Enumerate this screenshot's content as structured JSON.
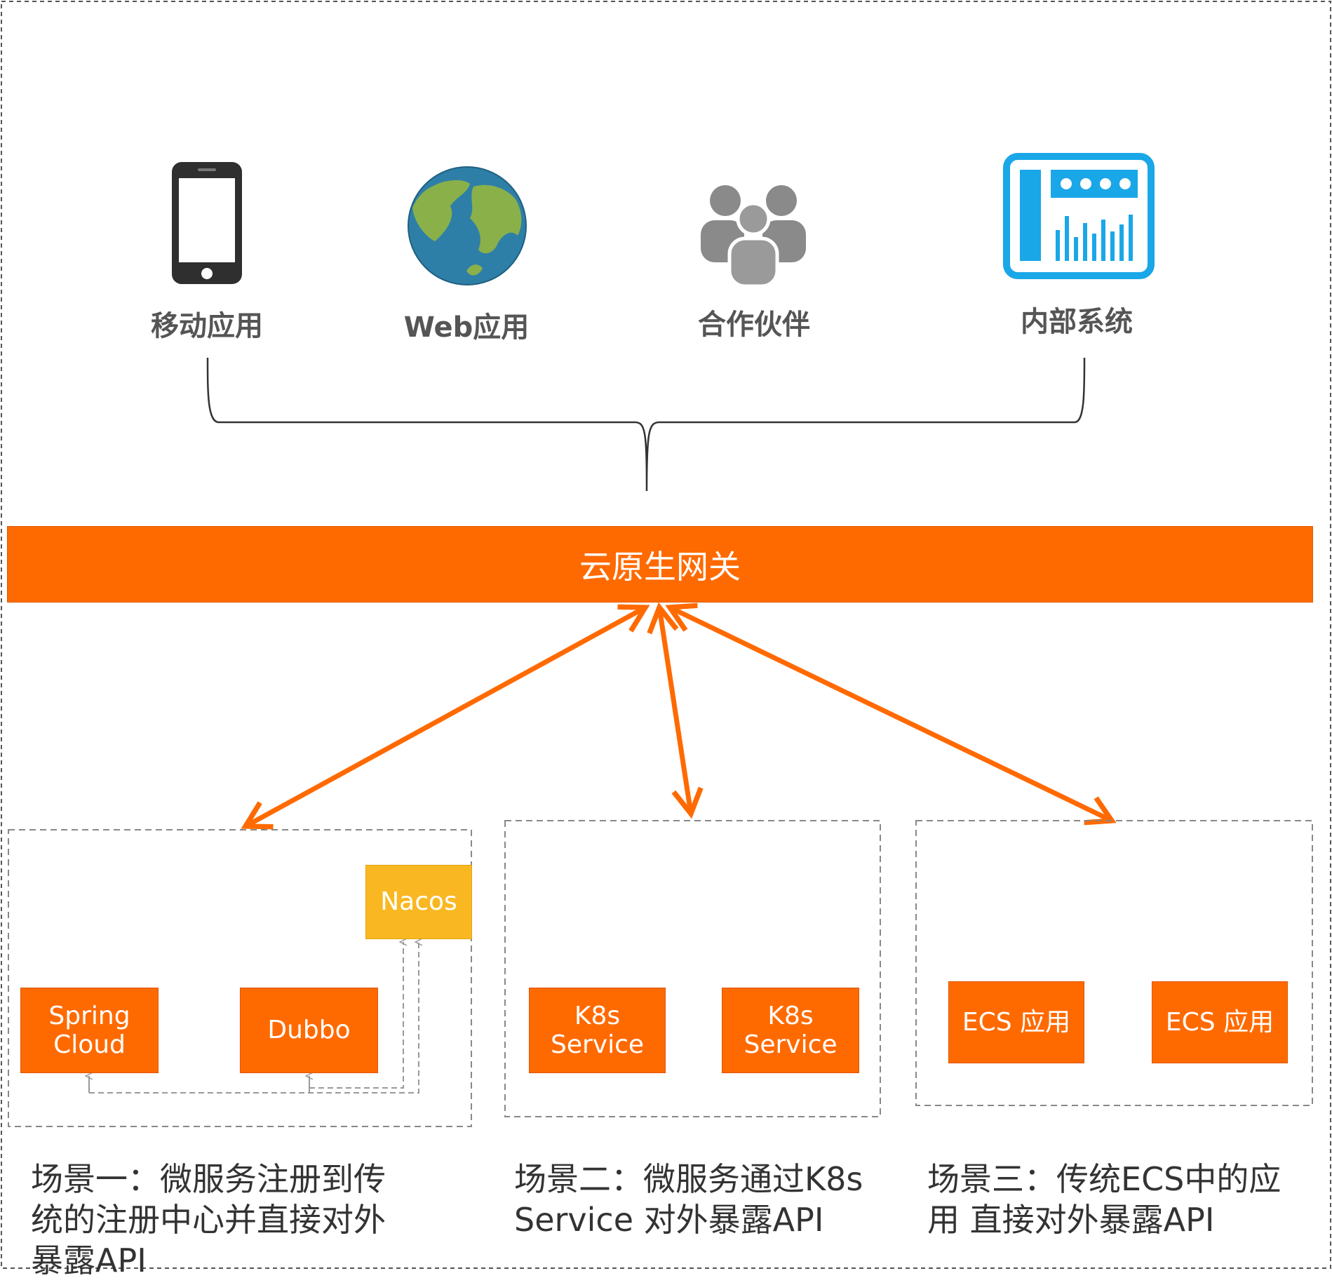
{
  "clients": [
    {
      "label": "移动应用",
      "icon": "mobile-phone-icon"
    },
    {
      "label": "Web应用",
      "icon": "globe-icon"
    },
    {
      "label": "合作伙伴",
      "icon": "partners-people-icon"
    },
    {
      "label": "内部系统",
      "icon": "dashboard-monitor-icon"
    }
  ],
  "gateway": {
    "label": "云原生网关"
  },
  "scenario1": {
    "registry_label": "Nacos",
    "services": [
      "Spring\nCloud",
      "Dubbo"
    ],
    "caption": "场景一：微服务注册到传统的注册中心并直接对外暴露API"
  },
  "scenario2": {
    "services": [
      "K8s\nService",
      "K8s\nService"
    ],
    "caption": "场景二：微服务通过K8s Service 对外暴露API"
  },
  "scenario3": {
    "services": [
      "ECS 应用",
      "ECS 应用"
    ],
    "caption": "场景三：传统ECS中的应用 直接对外暴露API"
  },
  "colors": {
    "accent": "#ff6a00",
    "registry": "#f9b822",
    "icon_blue": "#1aa7e8",
    "globe_ocean": "#2e7fa8",
    "globe_land": "#8ab04a",
    "people_gray": "#8a8a8a"
  }
}
